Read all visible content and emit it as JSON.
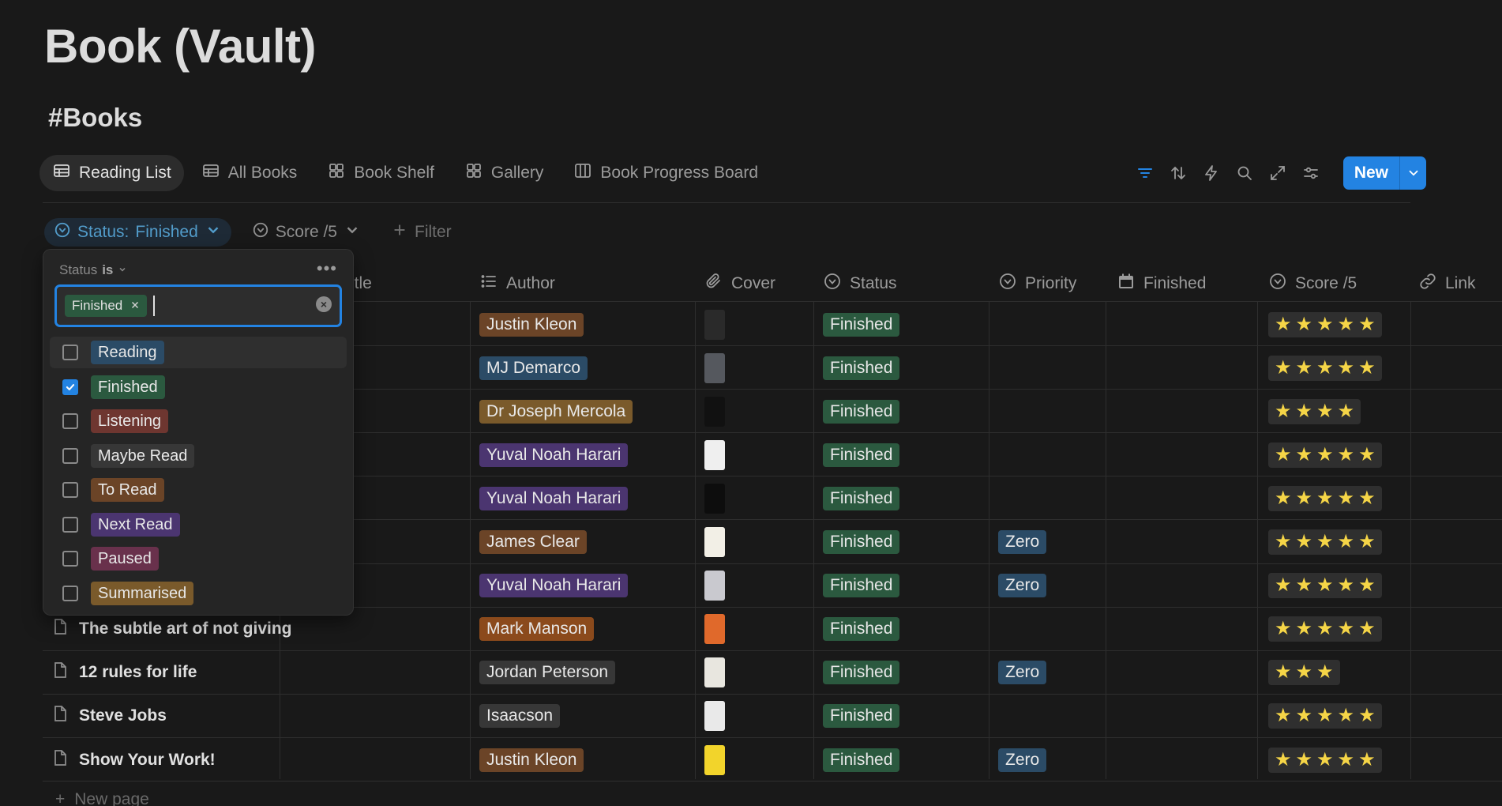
{
  "page": {
    "title": "Book (Vault)",
    "database": "#Books"
  },
  "views": [
    {
      "label": "Reading List",
      "icon": "table-icon"
    },
    {
      "label": "All Books",
      "icon": "table-icon"
    },
    {
      "label": "Book Shelf",
      "icon": "gallery-icon"
    },
    {
      "label": "Gallery",
      "icon": "gallery-icon"
    },
    {
      "label": "Book Progress Board",
      "icon": "board-icon"
    }
  ],
  "toolbar": {
    "new_label": "New"
  },
  "filters": {
    "status": {
      "prop": "Status",
      "sep": ":",
      "value": "Finished"
    },
    "score": "Score /5",
    "add": "Filter"
  },
  "columns": {
    "title_frag": "itle",
    "author": "Author",
    "cover": "Cover",
    "status": "Status",
    "priority": "Priority",
    "finished": "Finished",
    "score": "Score /5",
    "link": "Link"
  },
  "rows": [
    {
      "name": "",
      "author": "Justin Kleon",
      "author_color": "#6b4427",
      "cover": "#2a2a2a",
      "status": "Finished",
      "priority": "",
      "stars": 5
    },
    {
      "name": "",
      "author": "MJ Demarco",
      "author_color": "#2b4b66",
      "cover": "#55585e",
      "status": "Finished",
      "priority": "",
      "stars": 5
    },
    {
      "name": "",
      "author": "Dr Joseph Mercola",
      "author_color": "#7a5a2b",
      "cover": "#111111",
      "status": "Finished",
      "priority": "",
      "stars": 4
    },
    {
      "name": "",
      "author": "Yuval Noah Harari",
      "author_color": "#4b3570",
      "cover": "#efefef",
      "status": "Finished",
      "priority": "",
      "stars": 5
    },
    {
      "name": "",
      "author": "Yuval Noah Harari",
      "author_color": "#4b3570",
      "cover": "#0d0d0d",
      "status": "Finished",
      "priority": "",
      "stars": 5
    },
    {
      "name": "",
      "author": "James Clear",
      "author_color": "#6b4427",
      "cover": "#f2efe6",
      "status": "Finished",
      "priority": "Zero",
      "stars": 5
    },
    {
      "name": "",
      "author": "Yuval Noah Harari",
      "author_color": "#4b3570",
      "cover": "#c9c9cf",
      "status": "Finished",
      "priority": "Zero",
      "stars": 5
    },
    {
      "name": "The subtle art of not giving",
      "author": "Mark Manson",
      "author_color": "#8b4a1c",
      "cover": "#e0692b",
      "status": "Finished",
      "priority": "",
      "stars": 5
    },
    {
      "name": "12 rules for life",
      "author": "Jordan Peterson",
      "author_color": "#373737",
      "cover": "#e8e6df",
      "status": "Finished",
      "priority": "Zero",
      "stars": 3
    },
    {
      "name": "Steve Jobs",
      "author": "Isaacson",
      "author_color": "#373737",
      "cover": "#e9e9e9",
      "status": "Finished",
      "priority": "",
      "stars": 5
    },
    {
      "name": "Show Your Work!",
      "author": "Justin Kleon",
      "author_color": "#6b4427",
      "cover": "#f2d42b",
      "status": "Finished",
      "priority": "Zero",
      "stars": 5
    }
  ],
  "new_page": "New page",
  "dropdown": {
    "prop": "Status",
    "op": "is",
    "selected_chip": "Finished",
    "options": [
      {
        "label": "Reading",
        "color": "#2b4b66",
        "checked": false
      },
      {
        "label": "Finished",
        "color": "#2b593f",
        "checked": true
      },
      {
        "label": "Listening",
        "color": "#6e3630",
        "checked": false
      },
      {
        "label": "Maybe Read",
        "color": "#373737",
        "checked": false
      },
      {
        "label": "To Read",
        "color": "#6b4427",
        "checked": false
      },
      {
        "label": "Next Read",
        "color": "#4b3570",
        "checked": false
      },
      {
        "label": "Paused",
        "color": "#69314c",
        "checked": false
      },
      {
        "label": "Summarised",
        "color": "#7a5a2b",
        "checked": false
      }
    ]
  },
  "colors": {
    "accent": "#2383e2",
    "status_finished": "#2b593f",
    "priority_zero": "#2b4b66",
    "star": "#f5d547"
  }
}
